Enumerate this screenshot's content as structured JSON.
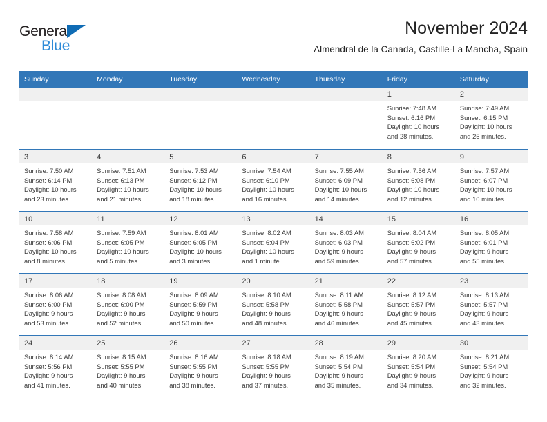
{
  "brand": {
    "name_top": "General",
    "name_bottom": "Blue",
    "triangle_color": "#0f6cb5",
    "text_color_top": "#231f20",
    "text_color_bottom": "#2e8bd8"
  },
  "header": {
    "title": "November 2024",
    "subtitle": "Almendral de la Canada, Castille-La Mancha, Spain"
  },
  "theme": {
    "header_band": "#3277b8",
    "daynum_band": "#f0f0f0",
    "row_divider": "#3277b8",
    "text": "#3a3a3a"
  },
  "weekdays": [
    "Sunday",
    "Monday",
    "Tuesday",
    "Wednesday",
    "Thursday",
    "Friday",
    "Saturday"
  ],
  "weeks": [
    [
      {
        "day": "",
        "lines": []
      },
      {
        "day": "",
        "lines": []
      },
      {
        "day": "",
        "lines": []
      },
      {
        "day": "",
        "lines": []
      },
      {
        "day": "",
        "lines": []
      },
      {
        "day": "1",
        "lines": [
          "Sunrise: 7:48 AM",
          "Sunset: 6:16 PM",
          "Daylight: 10 hours",
          "and 28 minutes."
        ]
      },
      {
        "day": "2",
        "lines": [
          "Sunrise: 7:49 AM",
          "Sunset: 6:15 PM",
          "Daylight: 10 hours",
          "and 25 minutes."
        ]
      }
    ],
    [
      {
        "day": "3",
        "lines": [
          "Sunrise: 7:50 AM",
          "Sunset: 6:14 PM",
          "Daylight: 10 hours",
          "and 23 minutes."
        ]
      },
      {
        "day": "4",
        "lines": [
          "Sunrise: 7:51 AM",
          "Sunset: 6:13 PM",
          "Daylight: 10 hours",
          "and 21 minutes."
        ]
      },
      {
        "day": "5",
        "lines": [
          "Sunrise: 7:53 AM",
          "Sunset: 6:12 PM",
          "Daylight: 10 hours",
          "and 18 minutes."
        ]
      },
      {
        "day": "6",
        "lines": [
          "Sunrise: 7:54 AM",
          "Sunset: 6:10 PM",
          "Daylight: 10 hours",
          "and 16 minutes."
        ]
      },
      {
        "day": "7",
        "lines": [
          "Sunrise: 7:55 AM",
          "Sunset: 6:09 PM",
          "Daylight: 10 hours",
          "and 14 minutes."
        ]
      },
      {
        "day": "8",
        "lines": [
          "Sunrise: 7:56 AM",
          "Sunset: 6:08 PM",
          "Daylight: 10 hours",
          "and 12 minutes."
        ]
      },
      {
        "day": "9",
        "lines": [
          "Sunrise: 7:57 AM",
          "Sunset: 6:07 PM",
          "Daylight: 10 hours",
          "and 10 minutes."
        ]
      }
    ],
    [
      {
        "day": "10",
        "lines": [
          "Sunrise: 7:58 AM",
          "Sunset: 6:06 PM",
          "Daylight: 10 hours",
          "and 8 minutes."
        ]
      },
      {
        "day": "11",
        "lines": [
          "Sunrise: 7:59 AM",
          "Sunset: 6:05 PM",
          "Daylight: 10 hours",
          "and 5 minutes."
        ]
      },
      {
        "day": "12",
        "lines": [
          "Sunrise: 8:01 AM",
          "Sunset: 6:05 PM",
          "Daylight: 10 hours",
          "and 3 minutes."
        ]
      },
      {
        "day": "13",
        "lines": [
          "Sunrise: 8:02 AM",
          "Sunset: 6:04 PM",
          "Daylight: 10 hours",
          "and 1 minute."
        ]
      },
      {
        "day": "14",
        "lines": [
          "Sunrise: 8:03 AM",
          "Sunset: 6:03 PM",
          "Daylight: 9 hours",
          "and 59 minutes."
        ]
      },
      {
        "day": "15",
        "lines": [
          "Sunrise: 8:04 AM",
          "Sunset: 6:02 PM",
          "Daylight: 9 hours",
          "and 57 minutes."
        ]
      },
      {
        "day": "16",
        "lines": [
          "Sunrise: 8:05 AM",
          "Sunset: 6:01 PM",
          "Daylight: 9 hours",
          "and 55 minutes."
        ]
      }
    ],
    [
      {
        "day": "17",
        "lines": [
          "Sunrise: 8:06 AM",
          "Sunset: 6:00 PM",
          "Daylight: 9 hours",
          "and 53 minutes."
        ]
      },
      {
        "day": "18",
        "lines": [
          "Sunrise: 8:08 AM",
          "Sunset: 6:00 PM",
          "Daylight: 9 hours",
          "and 52 minutes."
        ]
      },
      {
        "day": "19",
        "lines": [
          "Sunrise: 8:09 AM",
          "Sunset: 5:59 PM",
          "Daylight: 9 hours",
          "and 50 minutes."
        ]
      },
      {
        "day": "20",
        "lines": [
          "Sunrise: 8:10 AM",
          "Sunset: 5:58 PM",
          "Daylight: 9 hours",
          "and 48 minutes."
        ]
      },
      {
        "day": "21",
        "lines": [
          "Sunrise: 8:11 AM",
          "Sunset: 5:58 PM",
          "Daylight: 9 hours",
          "and 46 minutes."
        ]
      },
      {
        "day": "22",
        "lines": [
          "Sunrise: 8:12 AM",
          "Sunset: 5:57 PM",
          "Daylight: 9 hours",
          "and 45 minutes."
        ]
      },
      {
        "day": "23",
        "lines": [
          "Sunrise: 8:13 AM",
          "Sunset: 5:57 PM",
          "Daylight: 9 hours",
          "and 43 minutes."
        ]
      }
    ],
    [
      {
        "day": "24",
        "lines": [
          "Sunrise: 8:14 AM",
          "Sunset: 5:56 PM",
          "Daylight: 9 hours",
          "and 41 minutes."
        ]
      },
      {
        "day": "25",
        "lines": [
          "Sunrise: 8:15 AM",
          "Sunset: 5:55 PM",
          "Daylight: 9 hours",
          "and 40 minutes."
        ]
      },
      {
        "day": "26",
        "lines": [
          "Sunrise: 8:16 AM",
          "Sunset: 5:55 PM",
          "Daylight: 9 hours",
          "and 38 minutes."
        ]
      },
      {
        "day": "27",
        "lines": [
          "Sunrise: 8:18 AM",
          "Sunset: 5:55 PM",
          "Daylight: 9 hours",
          "and 37 minutes."
        ]
      },
      {
        "day": "28",
        "lines": [
          "Sunrise: 8:19 AM",
          "Sunset: 5:54 PM",
          "Daylight: 9 hours",
          "and 35 minutes."
        ]
      },
      {
        "day": "29",
        "lines": [
          "Sunrise: 8:20 AM",
          "Sunset: 5:54 PM",
          "Daylight: 9 hours",
          "and 34 minutes."
        ]
      },
      {
        "day": "30",
        "lines": [
          "Sunrise: 8:21 AM",
          "Sunset: 5:54 PM",
          "Daylight: 9 hours",
          "and 32 minutes."
        ]
      }
    ]
  ]
}
